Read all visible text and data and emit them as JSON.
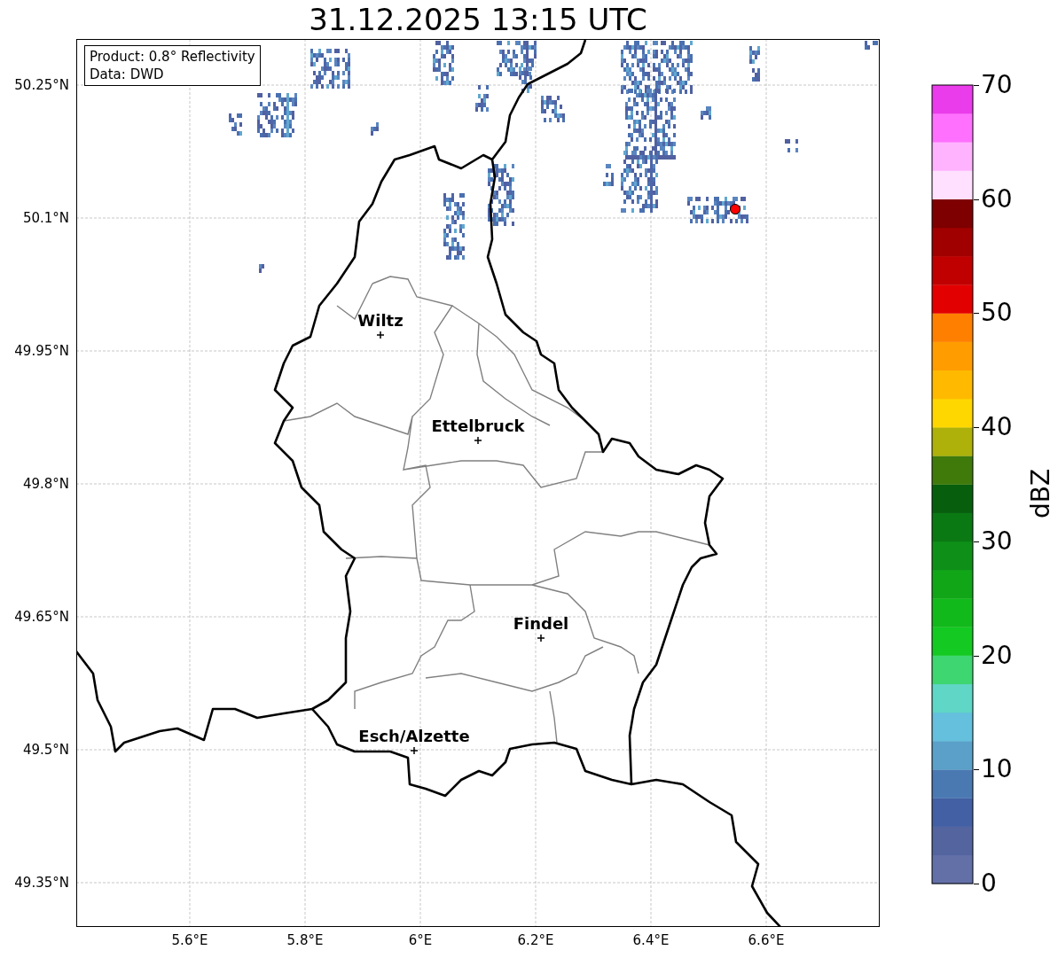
{
  "title": "31.12.2025 13:15 UTC",
  "info_box": {
    "lines": [
      "Product: 0.8° Reflectivity",
      "Data: DWD"
    ]
  },
  "lat_ticks": [
    "50.25°N",
    "50.1°N",
    "49.95°N",
    "49.8°N",
    "49.65°N",
    "49.5°N",
    "49.35°N"
  ],
  "lon_ticks": [
    "5.6°E",
    "5.8°E",
    "6°E",
    "6.2°E",
    "6.4°E",
    "6.6°E"
  ],
  "cities": [
    {
      "name": "Wiltz",
      "kind": "town"
    },
    {
      "name": "Ettelbruck",
      "kind": "town"
    },
    {
      "name": "Findel",
      "kind": "town"
    },
    {
      "name": "Esch/Alzette",
      "kind": "town"
    }
  ],
  "marker": {
    "color": "#ff0000"
  },
  "colorbar": {
    "label": "dBZ",
    "ticks": [
      "70",
      "60",
      "50",
      "40",
      "30",
      "20",
      "10",
      "0"
    ],
    "bins": [
      {
        "color": "#6370a8"
      },
      {
        "color": "#53649f"
      },
      {
        "color": "#4260a3"
      },
      {
        "color": "#4a79b2"
      },
      {
        "color": "#5aa0c8"
      },
      {
        "color": "#64c0dc"
      },
      {
        "color": "#60d6c6"
      },
      {
        "color": "#3ed671"
      },
      {
        "color": "#13c922"
      },
      {
        "color": "#12b91b"
      },
      {
        "color": "#10a617"
      },
      {
        "color": "#0e8f18"
      },
      {
        "color": "#0b7913"
      },
      {
        "color": "#075f0e"
      },
      {
        "color": "#3f7a0b"
      },
      {
        "color": "#adb10a"
      },
      {
        "color": "#fed700"
      },
      {
        "color": "#ffba00"
      },
      {
        "color": "#ff9d00"
      },
      {
        "color": "#ff8000"
      },
      {
        "color": "#e30000"
      },
      {
        "color": "#c00000"
      },
      {
        "color": "#a10000"
      },
      {
        "color": "#7e0000"
      },
      {
        "color": "#ffe0ff"
      },
      {
        "color": "#ffb3ff"
      },
      {
        "color": "#ff70ff"
      },
      {
        "color": "#eb3ceb"
      }
    ]
  }
}
